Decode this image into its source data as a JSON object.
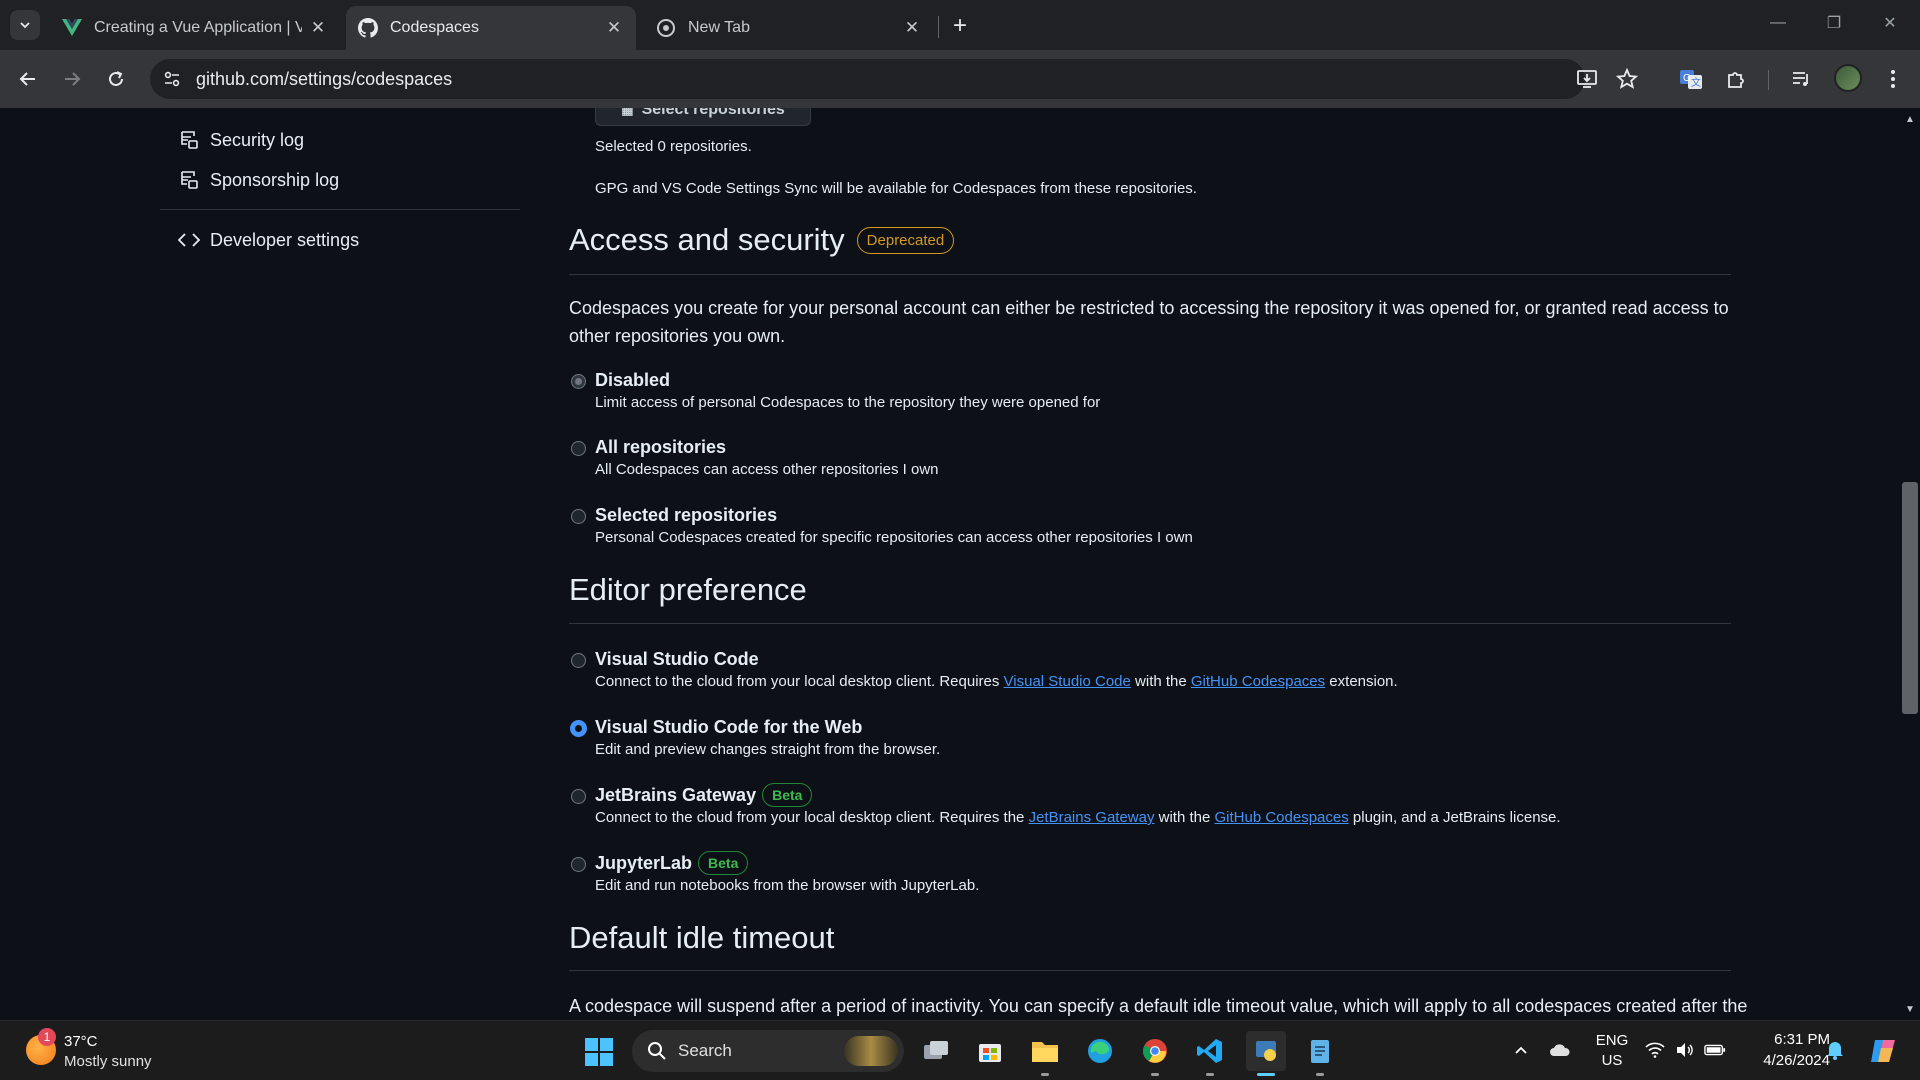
{
  "browser": {
    "tabs": [
      {
        "title": "Creating a Vue Application | Vue.js",
        "favicon": "vue-icon",
        "active": false
      },
      {
        "title": "Codespaces",
        "favicon": "github-icon",
        "active": true
      },
      {
        "title": "New Tab",
        "favicon": "chrome-icon",
        "active": false
      }
    ],
    "url": "github.com/settings/codespaces"
  },
  "sidebar": {
    "items": [
      {
        "label": "Security log",
        "icon": "log-icon"
      },
      {
        "label": "Sponsorship log",
        "icon": "log-icon"
      },
      {
        "label": "Developer settings",
        "icon": "code-icon"
      }
    ]
  },
  "main": {
    "select_repos_button": "Select repositories",
    "selected_count_text": "Selected 0 repositories.",
    "sync_note": "GPG and VS Code Settings Sync will be available for Codespaces from these repositories.",
    "access": {
      "heading": "Access and security",
      "badge": "Deprecated",
      "description": "Codespaces you create for your personal account can either be restricted to accessing the repository it was opened for, or granted read access to other repositories you own.",
      "options": [
        {
          "label": "Disabled",
          "desc": "Limit access of personal Codespaces to the repository they were opened for",
          "state": "disabled-checked"
        },
        {
          "label": "All repositories",
          "desc": "All Codespaces can access other repositories I own",
          "state": "unchecked"
        },
        {
          "label": "Selected repositories",
          "desc": "Personal Codespaces created for specific repositories can access other repositories I own",
          "state": "unchecked"
        }
      ]
    },
    "editor": {
      "heading": "Editor preference",
      "options": [
        {
          "label": "Visual Studio Code",
          "badge": "",
          "desc_pre": "Connect to the cloud from your local desktop client. Requires ",
          "link1": "Visual Studio Code",
          "desc_mid": " with the ",
          "link2": "GitHub Codespaces",
          "desc_post": " extension.",
          "checked": false
        },
        {
          "label": "Visual Studio Code for the Web",
          "badge": "",
          "desc_pre": "Edit and preview changes straight from the browser.",
          "checked": true
        },
        {
          "label": "JetBrains Gateway",
          "badge": "Beta",
          "desc_pre": "Connect to the cloud from your local desktop client. Requires the ",
          "link1": "JetBrains Gateway",
          "desc_mid": " with the ",
          "link2": "GitHub Codespaces",
          "desc_post": " plugin, and a JetBrains license.",
          "checked": false
        },
        {
          "label": "JupyterLab",
          "badge": "Beta",
          "desc_pre": "Edit and run notebooks from the browser with JupyterLab.",
          "checked": false
        }
      ]
    },
    "idle": {
      "heading": "Default idle timeout",
      "description": "A codespace will suspend after a period of inactivity. You can specify a default idle timeout value, which will apply to all codespaces created after the"
    }
  },
  "taskbar": {
    "weather_temp": "37°C",
    "weather_desc": "Mostly sunny",
    "weather_badge": "1",
    "search_placeholder": "Search",
    "lang_top": "ENG",
    "lang_bottom": "US",
    "time": "6:31 PM",
    "date": "4/26/2024"
  }
}
